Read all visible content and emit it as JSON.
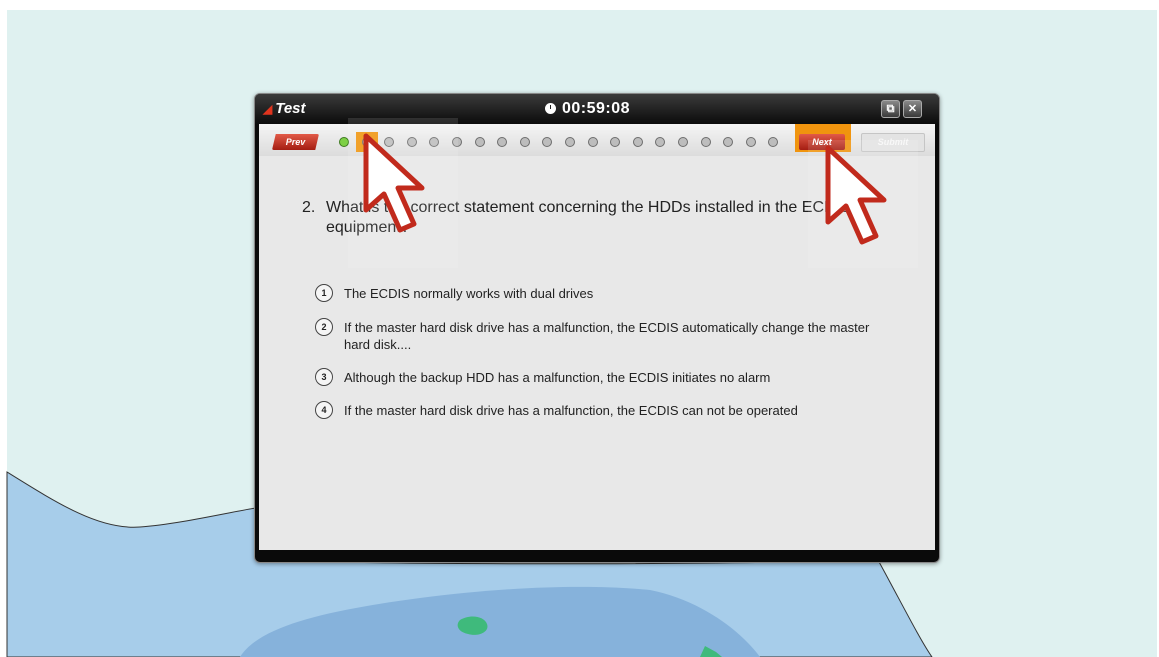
{
  "window": {
    "title": "Test",
    "timer": "00:59:08",
    "restore_glyph": "⧉",
    "close_glyph": "✕"
  },
  "nav": {
    "prev_label": "Prev",
    "next_label": "Next",
    "submit_label": "Submit",
    "question_count": 20,
    "answered": [
      1
    ],
    "current": 2,
    "highlight_color": "#f0940e"
  },
  "question": {
    "number": "2.",
    "text": "What is the correct statement concerning the HDDs installed in the ECDIS equipment?"
  },
  "options": [
    {
      "num": "1",
      "text": "The ECDIS normally works with dual drives"
    },
    {
      "num": "2",
      "text": "If the master hard disk drive has a malfunction, the ECDIS automatically change the master hard disk...."
    },
    {
      "num": "3",
      "text": "Although the backup HDD has a malfunction, the ECDIS initiates no alarm"
    },
    {
      "num": "4",
      "text": "If the master hard disk drive has a malfunction, the ECDIS can not be operated"
    }
  ],
  "colors": {
    "land": "#dff1f0",
    "sea_shallow": "#a7cdea",
    "sea_deep": "#86b2db",
    "shoal": "#3fba7c",
    "accent_red": "#c12a1c"
  },
  "icons": [
    "flame-icon",
    "clock-icon",
    "restore-icon",
    "close-icon",
    "mouse-pointer-icon"
  ]
}
